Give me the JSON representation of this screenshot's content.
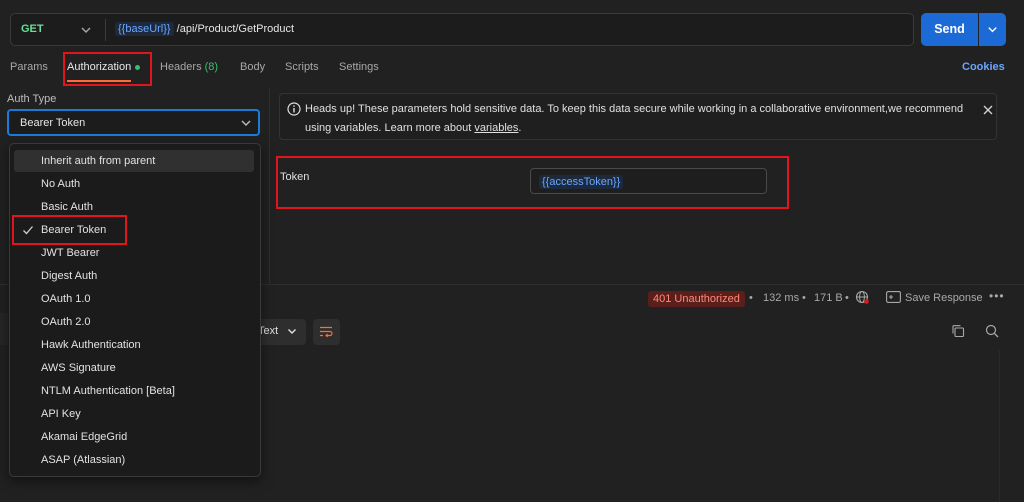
{
  "request": {
    "method": "GET",
    "url_variable": "{{baseUrl}}",
    "url_path": "/api/Product/GetProduct",
    "send_label": "Send"
  },
  "tabs": [
    {
      "label": "Params",
      "active": false
    },
    {
      "label": "Authorization",
      "active": true
    },
    {
      "label": "Headers",
      "count": "(8)",
      "active": false
    },
    {
      "label": "Body",
      "active": false
    },
    {
      "label": "Scripts",
      "active": false
    },
    {
      "label": "Settings",
      "active": false
    }
  ],
  "cookies_label": "Cookies",
  "auth": {
    "type_label": "Auth Type",
    "selected": "Bearer Token",
    "options": [
      "Inherit auth from parent",
      "No Auth",
      "Basic Auth",
      "Bearer Token",
      "JWT Bearer",
      "Digest Auth",
      "OAuth 1.0",
      "OAuth 2.0",
      "Hawk Authentication",
      "AWS Signature",
      "NTLM Authentication [Beta]",
      "API Key",
      "Akamai EdgeGrid",
      "ASAP (Atlassian)"
    ]
  },
  "banner": {
    "text": "Heads up! These parameters hold sensitive data. To keep this data secure while working in a collaborative environment,we recommend using variables. Learn more about",
    "link": "variables",
    "end": "."
  },
  "token": {
    "label": "Token",
    "value": "{{accessToken}}"
  },
  "response": {
    "status": "401 Unauthorized",
    "time": "132 ms",
    "size": "171 B",
    "save_label": "Save Response",
    "more": "•••",
    "format": "Text"
  },
  "colors": {
    "accent_blue": "#1c6ad6",
    "method_green": "#6bdd9a",
    "highlight_red": "#e2141c",
    "status_red": "#ff8a7a"
  }
}
